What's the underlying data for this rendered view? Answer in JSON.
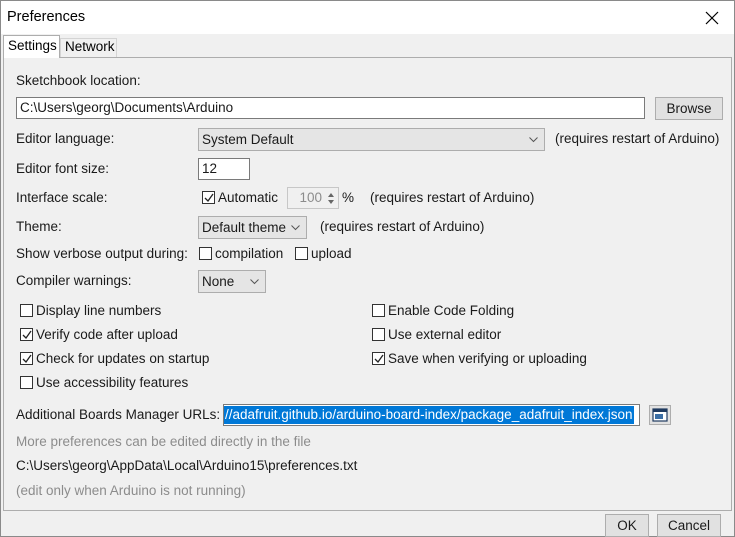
{
  "window": {
    "title": "Preferences"
  },
  "tabs": {
    "settings": "Settings",
    "network": "Network"
  },
  "sketchbook": {
    "label": "Sketchbook location:",
    "value": "C:\\Users\\georg\\Documents\\Arduino",
    "browse": "Browse"
  },
  "editor_language": {
    "label": "Editor language:",
    "value": "System Default",
    "note": "(requires restart of Arduino)"
  },
  "editor_font_size": {
    "label": "Editor font size:",
    "value": "12"
  },
  "interface_scale": {
    "label": "Interface scale:",
    "automatic": "Automatic",
    "value": "100",
    "unit": "%",
    "note": "(requires restart of Arduino)"
  },
  "theme": {
    "label": "Theme:",
    "value": "Default theme",
    "note": "(requires restart of Arduino)"
  },
  "verbose": {
    "label": "Show verbose output during:",
    "compilation": "compilation",
    "upload": "upload"
  },
  "compiler_warnings": {
    "label": "Compiler warnings:",
    "value": "None"
  },
  "options": {
    "display_line_numbers": "Display line numbers",
    "verify_code": "Verify code after upload",
    "check_updates": "Check for updates on startup",
    "accessibility": "Use accessibility features",
    "code_folding": "Enable Code Folding",
    "external_editor": "Use external editor",
    "save_when_verifying": "Save when verifying or uploading"
  },
  "boards_urls": {
    "label": "Additional Boards Manager URLs:",
    "value": "//adafruit.github.io/arduino-board-index/package_adafruit_index.json"
  },
  "footer": {
    "more_prefs": "More preferences can be edited directly in the file",
    "prefs_path": "C:\\Users\\georg\\AppData\\Local\\Arduino15\\preferences.txt",
    "edit_note": "(edit only when Arduino is not running)"
  },
  "buttons": {
    "ok": "OK",
    "cancel": "Cancel"
  }
}
